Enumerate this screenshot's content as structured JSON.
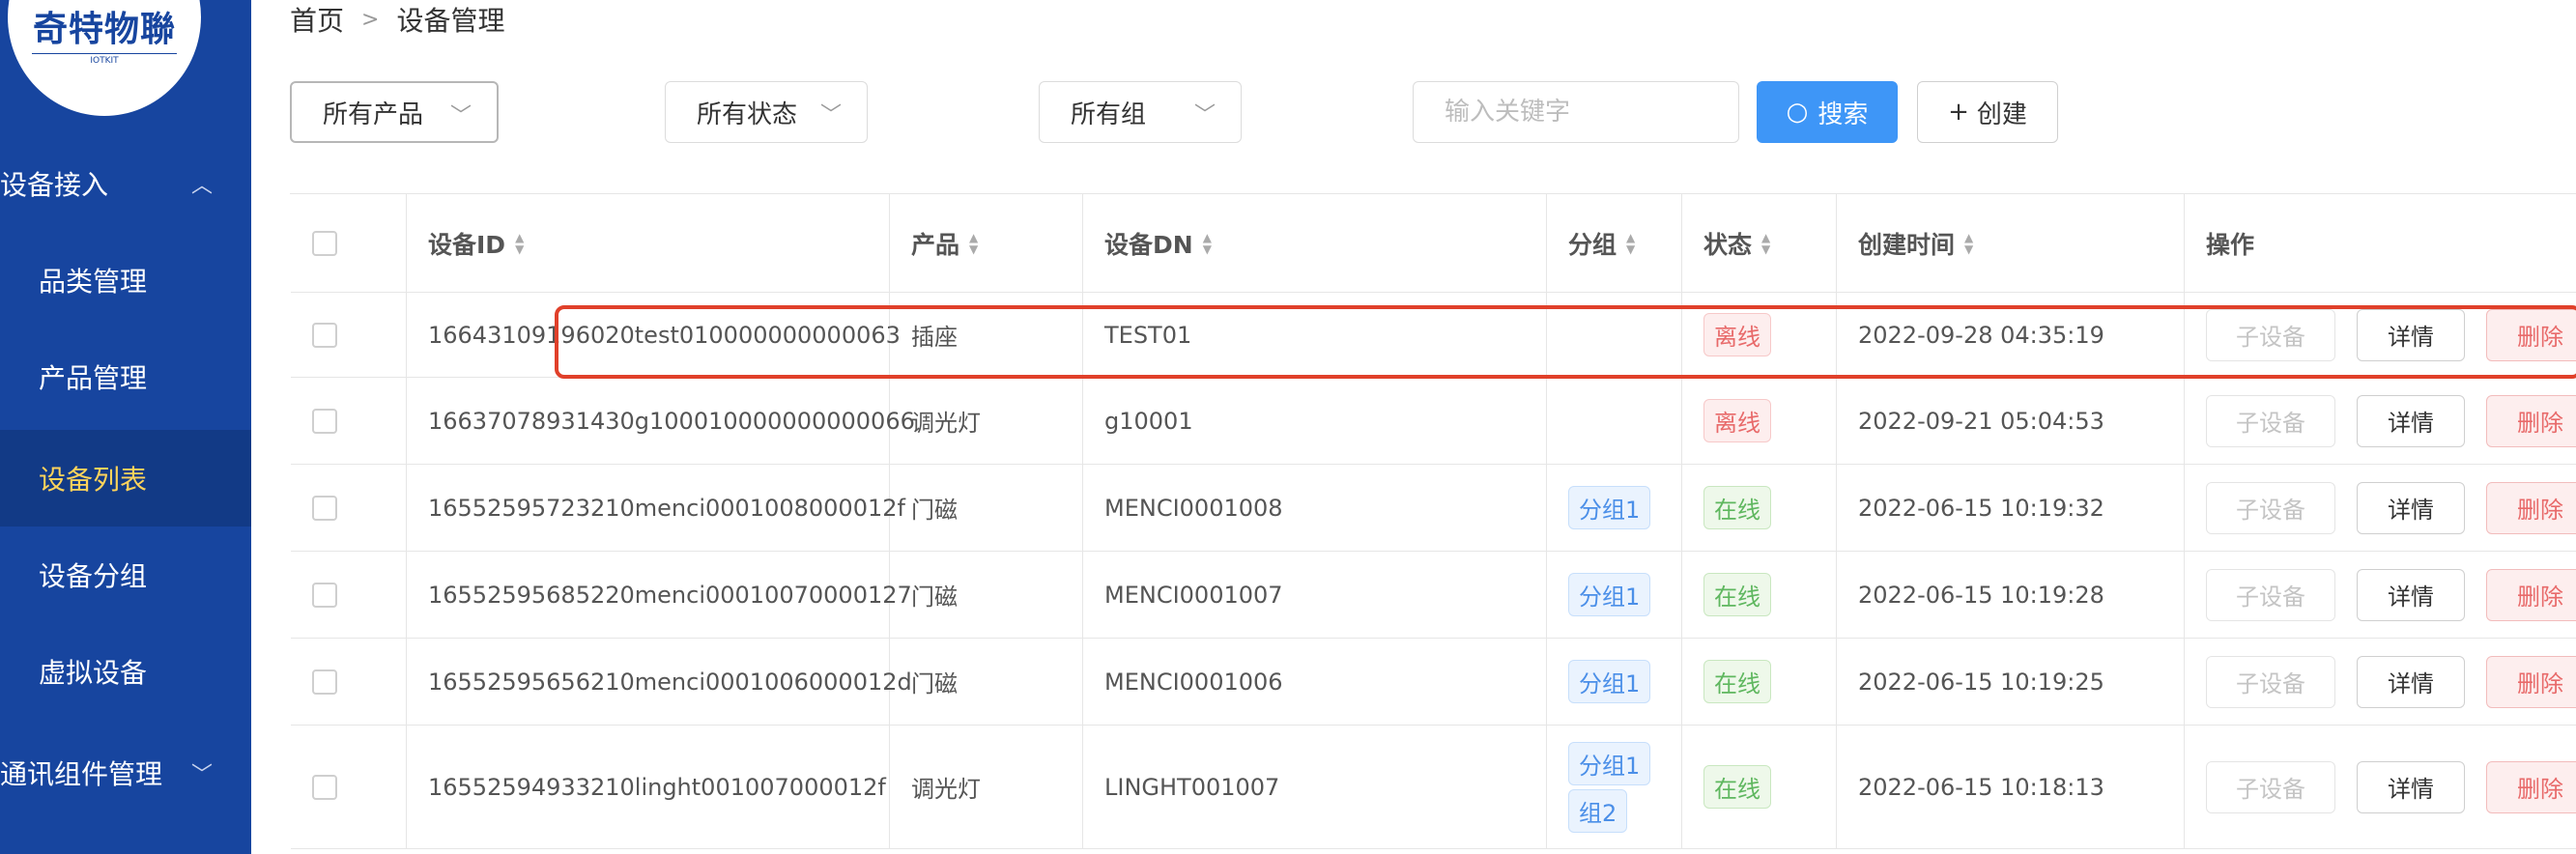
{
  "logo": {
    "text": "奇特物聯",
    "sub": "IOTKIT"
  },
  "sidebar": {
    "groups": [
      {
        "label": "设备接入",
        "chevron": "up"
      },
      {
        "label": "通讯组件管理",
        "chevron": "down"
      }
    ],
    "items": [
      {
        "label": "品类管理"
      },
      {
        "label": "产品管理"
      },
      {
        "label": "设备列表",
        "active": true
      },
      {
        "label": "设备分组"
      },
      {
        "label": "虚拟设备"
      }
    ]
  },
  "breadcrumb": {
    "home": "首页",
    "current": "设备管理"
  },
  "filters": {
    "product": "所有产品",
    "status": "所有状态",
    "group": "所有组",
    "keyword_placeholder": "输入关键字",
    "search_label": "搜索",
    "create_label": "创建"
  },
  "table": {
    "columns": [
      "设备ID",
      "产品",
      "设备DN",
      "分组",
      "状态",
      "创建时间",
      "操作"
    ],
    "rows": [
      {
        "id": "16643109196020test010000000000063",
        "product": "插座",
        "dn": "TEST01",
        "groups": [],
        "status": "离线",
        "online": false,
        "created": "2022-09-28 04:35:19"
      },
      {
        "id": "16637078931430g100010000000000066",
        "product": "调光灯",
        "dn": "g10001",
        "groups": [],
        "status": "离线",
        "online": false,
        "created": "2022-09-21 05:04:53"
      },
      {
        "id": "16552595723210menci0001008000012f",
        "product": "门磁",
        "dn": "MENCI0001008",
        "groups": [
          "分组1"
        ],
        "status": "在线",
        "online": true,
        "created": "2022-06-15 10:19:32"
      },
      {
        "id": "16552595685220menci00010070000127",
        "product": "门磁",
        "dn": "MENCI0001007",
        "groups": [
          "分组1"
        ],
        "status": "在线",
        "online": true,
        "created": "2022-06-15 10:19:28"
      },
      {
        "id": "16552595656210menci0001006000012d",
        "product": "门磁",
        "dn": "MENCI0001006",
        "groups": [
          "分组1"
        ],
        "status": "在线",
        "online": true,
        "created": "2022-06-15 10:19:25"
      },
      {
        "id": "16552594933210linght001007000012f",
        "product": "调光灯",
        "dn": "LINGHT001007",
        "groups": [
          "分组1",
          "组2"
        ],
        "status": "在线",
        "online": true,
        "created": "2022-06-15 10:18:13"
      }
    ],
    "actions": {
      "sub": "子设备",
      "detail": "详情",
      "delete": "删除"
    }
  },
  "colors": {
    "sidebar": "#17459f",
    "active_item": "#ffd35b",
    "primary": "#3e96f7",
    "highlight": "#e0402a",
    "offline": "#e86a6a",
    "online": "#5fb75f"
  }
}
